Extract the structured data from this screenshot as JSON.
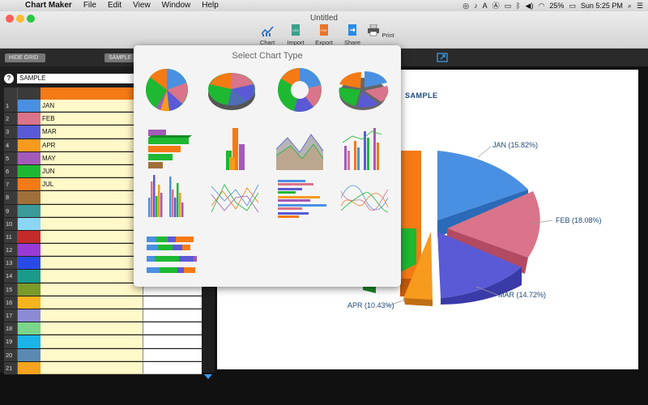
{
  "menubar": {
    "apple_glyph": "",
    "app_name": "Chart Maker",
    "items": [
      "File",
      "Edit",
      "View",
      "Window",
      "Help"
    ],
    "battery": "25%",
    "clock": "Sun 5:25 PM"
  },
  "window": {
    "title": "Untitled"
  },
  "toolbar": {
    "chart_label": "Chart",
    "import_label": "Import",
    "export_label": "Export",
    "share_label": "Share",
    "print_label": "Print"
  },
  "topbar": {
    "hide_grid": "HIDE GRID",
    "sample_btn": "SAMPLE"
  },
  "sheet": {
    "help": "?",
    "name": "SAMPLE",
    "rows": [
      {
        "num": "1",
        "label": "JAN",
        "color": "#4a90e2"
      },
      {
        "num": "2",
        "label": "FEB",
        "color": "#d9748a"
      },
      {
        "num": "3",
        "label": "MAR",
        "color": "#5a5ad6"
      },
      {
        "num": "4",
        "label": "APR",
        "color": "#f79a1e"
      },
      {
        "num": "5",
        "label": "MAY",
        "color": "#a45ab8"
      },
      {
        "num": "6",
        "label": "JUN",
        "color": "#1eb832"
      },
      {
        "num": "7",
        "label": "JUL",
        "color": "#f47a16"
      },
      {
        "num": "8",
        "label": "",
        "color": "#a0703a"
      },
      {
        "num": "9",
        "label": "",
        "color": "#3a9a9a"
      },
      {
        "num": "10",
        "label": "",
        "color": "#8ad6f4"
      },
      {
        "num": "11",
        "label": "",
        "color": "#c42a2a"
      },
      {
        "num": "12",
        "label": "",
        "color": "#9a3ad6"
      },
      {
        "num": "13",
        "label": "",
        "color": "#2a4ae8"
      },
      {
        "num": "14",
        "label": "",
        "color": "#1a9a8a"
      },
      {
        "num": "15",
        "label": "",
        "color": "#7a9a2a"
      },
      {
        "num": "16",
        "label": "",
        "color": "#f4b41e"
      },
      {
        "num": "17",
        "label": "",
        "color": "#8a8ad6"
      },
      {
        "num": "18",
        "label": "",
        "color": "#7ad68a"
      },
      {
        "num": "19",
        "label": "",
        "color": "#1ab4e8"
      },
      {
        "num": "20",
        "label": "",
        "color": "#5a8ab4"
      },
      {
        "num": "21",
        "label": "",
        "color": "#f4a41e"
      }
    ]
  },
  "chart": {
    "title": "SAMPLE",
    "labels": {
      "jan": "JAN (15.82%)",
      "feb": "FEB (18.08%)",
      "mar": "MAR (14.72%)",
      "apr": "APR (10.43%)"
    }
  },
  "popover": {
    "title": "Select Chart Type"
  },
  "colors": {
    "accent_blue": "#3a9be8",
    "header_orange": "#f47a16",
    "title_navy": "#1c4a79"
  }
}
